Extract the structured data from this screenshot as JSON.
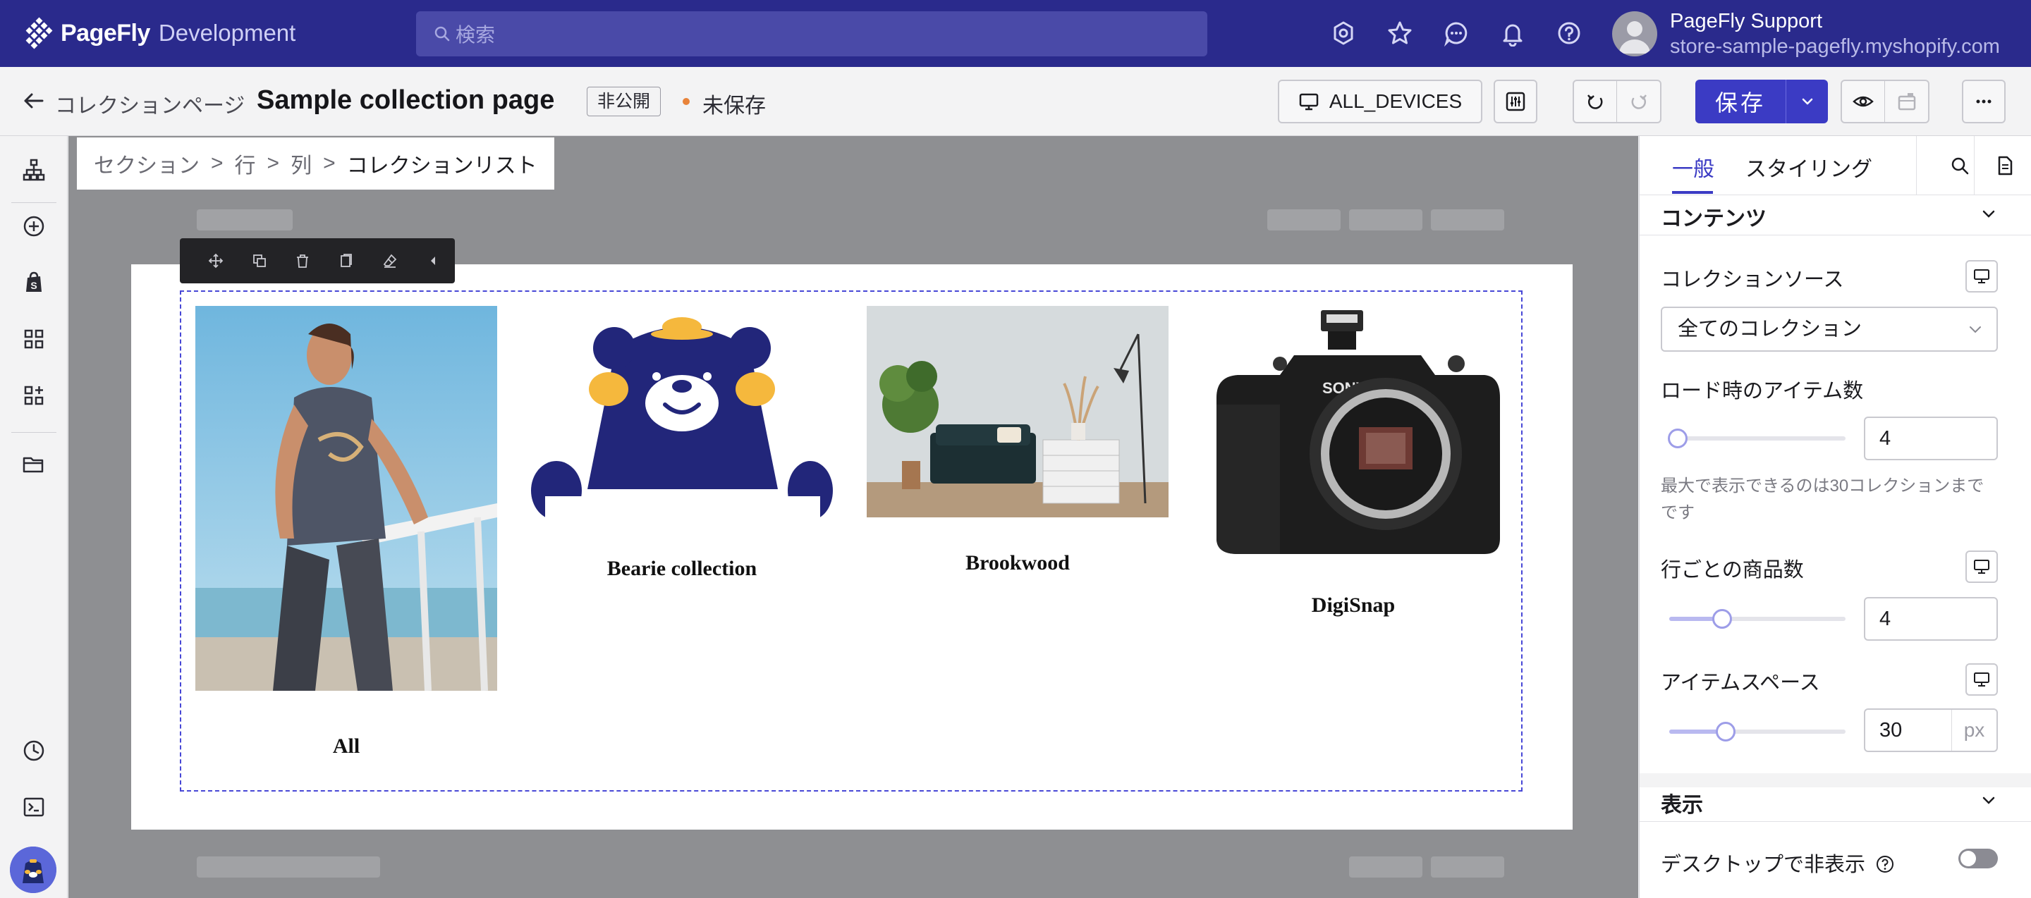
{
  "topbar": {
    "brand": "PageFly",
    "brand_sub": "Development",
    "search_placeholder": "検索",
    "user_name": "PageFly Support",
    "user_store": "store-sample-pagefly.myshopify.com",
    "icons": [
      "settings-icon",
      "star-icon",
      "chat-icon",
      "bell-icon",
      "help-icon"
    ],
    "bg_color": "#2a2a8c"
  },
  "editor": {
    "back_label": "コレクションページ",
    "page_title": "Sample collection page",
    "status_badge": "非公開",
    "unsaved_label": "未保存",
    "device_label": "ALL_DEVICES",
    "save_label": "保存",
    "accent_color": "#3b3bc4",
    "unsaved_dot_color": "#e8833a"
  },
  "rail": {
    "icons": [
      "layers-icon",
      "add-icon",
      "shopify-icon",
      "grid-icon",
      "apps-icon",
      "folder-icon",
      "history-icon",
      "terminal-icon"
    ]
  },
  "canvas": {
    "breadcrumb": [
      "セクション",
      "行",
      "列",
      "コレクションリスト"
    ],
    "toolbar_icons": [
      "move-icon",
      "duplicate-icon",
      "delete-icon",
      "copy-icon",
      "eraser-icon",
      "collapse-icon"
    ],
    "collections": [
      {
        "title": "All",
        "image": "woman-stretching-photo"
      },
      {
        "title": "Bearie collection",
        "image": "bear-mascot-illustration"
      },
      {
        "title": "Brookwood",
        "image": "living-room-photo"
      },
      {
        "title": "DigiSnap",
        "image": "sony-camera-photo"
      }
    ]
  },
  "panel": {
    "tabs": [
      "一般",
      "スタイリング"
    ],
    "active_tab": "一般",
    "content_section": "コンテンツ",
    "collection_source_label": "コレクションソース",
    "collection_source_value": "全てのコレクション",
    "items_on_load_label": "ロード時のアイテム数",
    "items_on_load_value": "4",
    "items_on_load_slider": 0.0,
    "items_help": "最大で表示できるのは30コレクションまでです",
    "per_row_label": "行ごとの商品数",
    "per_row_value": "4",
    "per_row_slider": 0.25,
    "item_space_label": "アイテムスペース",
    "item_space_value": "30",
    "item_space_unit": "px",
    "item_space_slider": 0.27,
    "display_section": "表示",
    "hide_desktop_label": "デスクトップで非表示",
    "hide_desktop_value": false
  }
}
